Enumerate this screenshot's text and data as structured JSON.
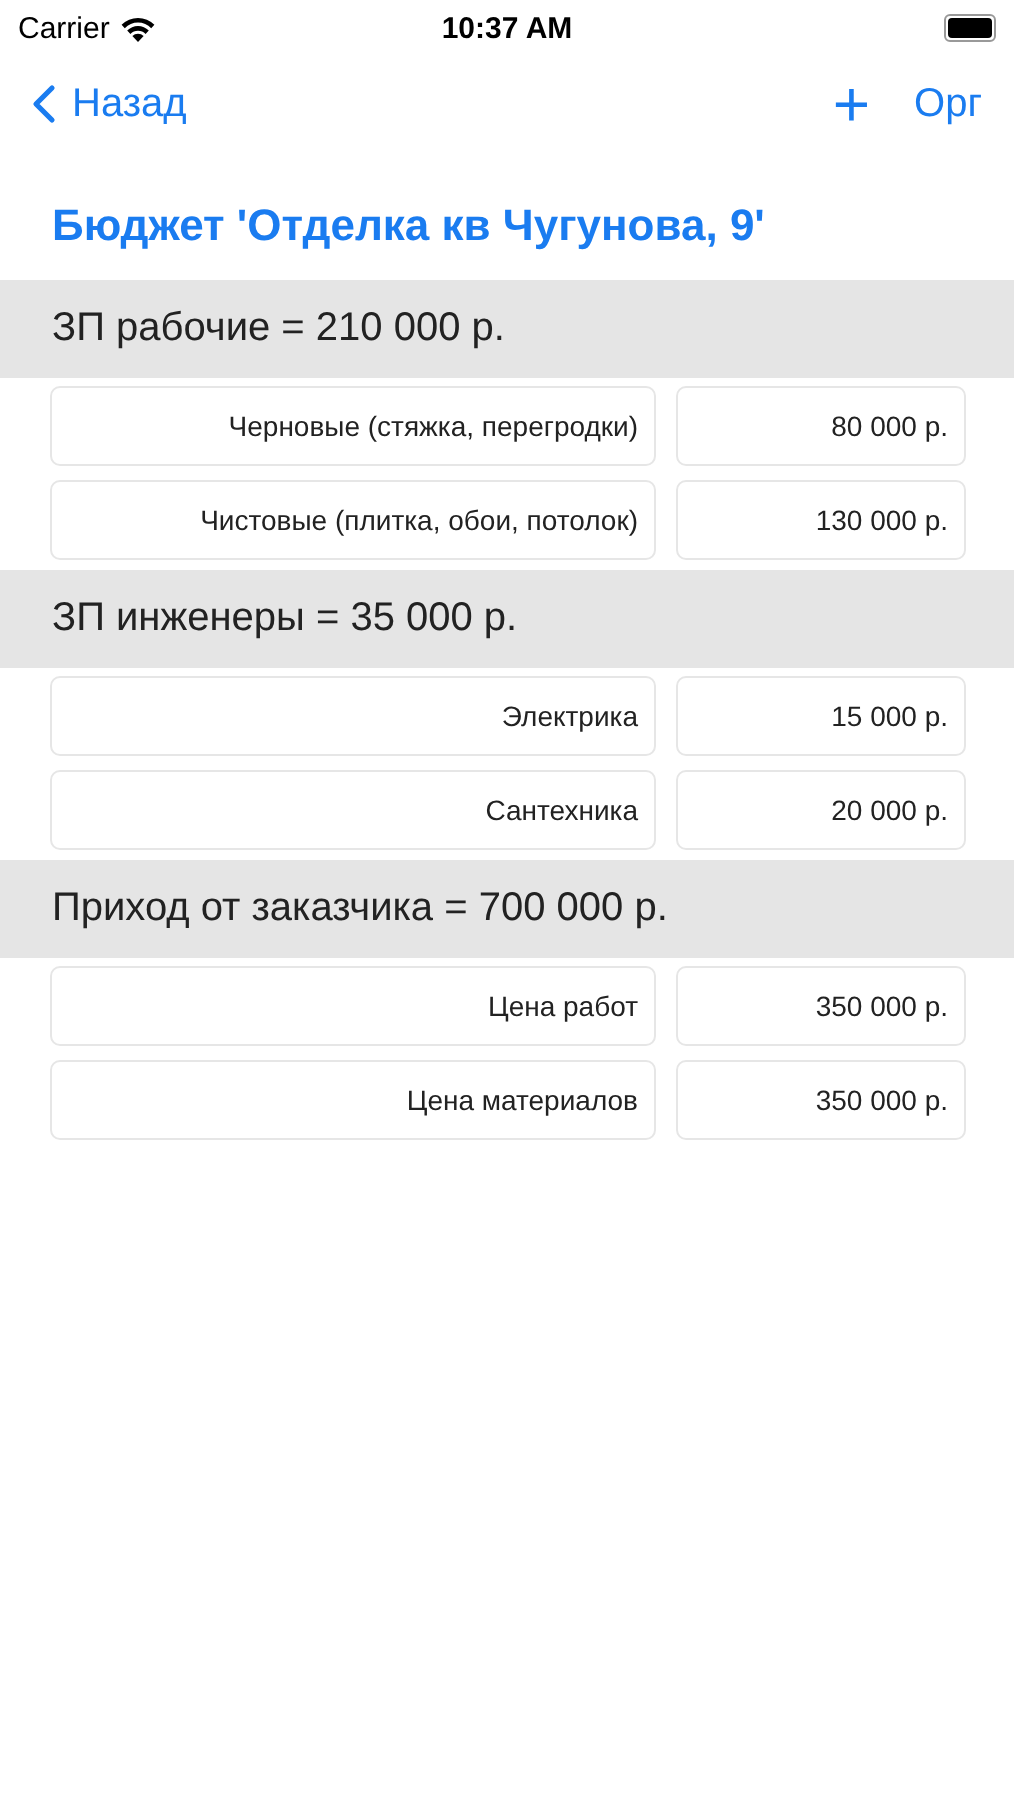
{
  "status_bar": {
    "carrier": "Carrier",
    "time": "10:37 AM"
  },
  "nav_bar": {
    "back": "Назад",
    "add": "+",
    "right": "Орг"
  },
  "title": "Бюджет 'Отделка кв Чугунова, 9'",
  "sections": [
    {
      "header": "ЗП рабочие = 210 000 р.",
      "rows": [
        {
          "label": "Черновые (стяжка, перегродки)",
          "value": "80 000 р."
        },
        {
          "label": "Чистовые (плитка, обои, потолок)",
          "value": "130 000 р."
        }
      ]
    },
    {
      "header": "ЗП инженеры = 35 000 р.",
      "rows": [
        {
          "label": "Электрика",
          "value": "15 000 р."
        },
        {
          "label": "Сантехника",
          "value": "20 000 р."
        }
      ]
    },
    {
      "header": "Приход от заказчика = 700 000 р.",
      "rows": [
        {
          "label": "Цена работ",
          "value": "350 000 р."
        },
        {
          "label": "Цена материалов",
          "value": "350 000 р."
        }
      ]
    }
  ]
}
